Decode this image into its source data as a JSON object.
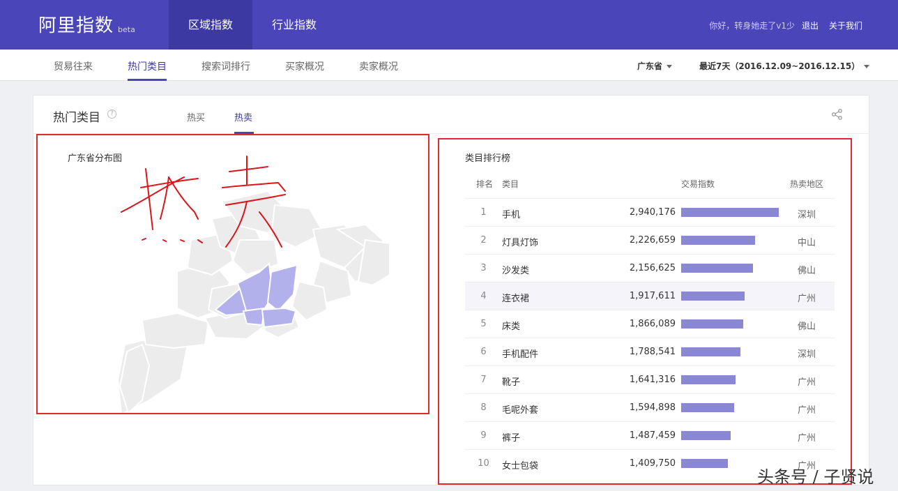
{
  "header": {
    "logo": "阿里指数",
    "logo_tag": "beta",
    "tabs": [
      {
        "label": "区域指数",
        "active": true
      },
      {
        "label": "行业指数",
        "active": false
      }
    ],
    "greeting": "你好，转身她走了v1少",
    "logout": "退出",
    "about": "关于我们"
  },
  "subnav": {
    "items": [
      {
        "label": "贸易往来",
        "active": false
      },
      {
        "label": "热门类目",
        "active": true
      },
      {
        "label": "搜索词排行",
        "active": false
      },
      {
        "label": "买家概况",
        "active": false
      },
      {
        "label": "卖家概况",
        "active": false
      }
    ],
    "region_filter": "广东省",
    "date_filter": "最近7天（2016.12.09~2016.12.15）"
  },
  "card": {
    "title": "热门类目",
    "help_icon": "?",
    "tabs": [
      {
        "label": "热买",
        "active": false
      },
      {
        "label": "热卖",
        "active": true
      }
    ]
  },
  "map": {
    "label": "广东省分布图",
    "highlight_color": "#b3b1eb",
    "base_color": "#ececec"
  },
  "ranking": {
    "title": "类目排行榜",
    "columns": [
      "排名",
      "类目",
      "交易指数",
      "热卖地区"
    ],
    "bar_color": "#8a88d6",
    "rows": [
      {
        "rank": "1",
        "category": "手机",
        "value": "2,940,176",
        "ratio": 1.0,
        "region": "深圳"
      },
      {
        "rank": "2",
        "category": "灯具灯饰",
        "value": "2,226,659",
        "ratio": 0.757,
        "region": "中山"
      },
      {
        "rank": "3",
        "category": "沙发类",
        "value": "2,156,625",
        "ratio": 0.733,
        "region": "佛山"
      },
      {
        "rank": "4",
        "category": "连衣裙",
        "value": "1,917,611",
        "ratio": 0.652,
        "region": "广州"
      },
      {
        "rank": "5",
        "category": "床类",
        "value": "1,866,089",
        "ratio": 0.635,
        "region": "佛山"
      },
      {
        "rank": "6",
        "category": "手机配件",
        "value": "1,788,541",
        "ratio": 0.608,
        "region": "深圳"
      },
      {
        "rank": "7",
        "category": "靴子",
        "value": "1,641,316",
        "ratio": 0.558,
        "region": "广州"
      },
      {
        "rank": "8",
        "category": "毛呢外套",
        "value": "1,594,898",
        "ratio": 0.542,
        "region": "广州"
      },
      {
        "rank": "9",
        "category": "裤子",
        "value": "1,487,459",
        "ratio": 0.506,
        "region": "广州"
      },
      {
        "rank": "10",
        "category": "女士包袋",
        "value": "1,409,750",
        "ratio": 0.479,
        "region": "广州"
      }
    ]
  },
  "annotation": {
    "handwriting": "热卖",
    "stroke_color": "#d9161c"
  },
  "watermark": "头条号 / 子贤说"
}
